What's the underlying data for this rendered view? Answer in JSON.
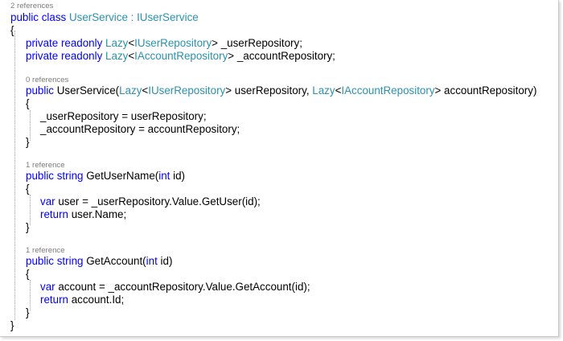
{
  "code_lens": {
    "class_refs": "2 references",
    "ctor_refs": "0 references",
    "getusername_refs": "1 reference",
    "getaccount_refs": "1 reference"
  },
  "tokens": {
    "public": "public",
    "class": "class",
    "private": "private",
    "readonly": "readonly",
    "string": "string",
    "int": "int",
    "var": "var",
    "return": "return",
    "Lazy": "Lazy",
    "IUserService": "IUserService",
    "IUserRepository": "IUserRepository",
    "IAccountRepository": "IAccountRepository"
  },
  "code": {
    "class_name": " UserService : ",
    "brace_open": "{",
    "brace_close": "}",
    "field1_lt": "<",
    "field1_rest": "> _userRepository;",
    "field2_lt": "<",
    "field2_rest": "> _accountRepository;",
    "ctor_name": " UserService(",
    "ctor_lt1": "<",
    "ctor_mid": "> userRepository, ",
    "ctor_lt2": "<",
    "ctor_end": "> accountRepository)",
    "ctor_body1": "_userRepository = userRepository;",
    "ctor_body2": "_accountRepository = accountRepository;",
    "m1_sig_a": " GetUserName(",
    "m1_sig_b": " id)",
    "m1_body1": " user = _userRepository.Value.GetUser(id);",
    "m1_body2": " user.Name;",
    "m2_sig_a": " GetAccount(",
    "m2_sig_b": " id)",
    "m2_body1": " account = _accountRepository.Value.GetAccount(id);",
    "m2_body2": " account.Id;"
  },
  "colors": {
    "keyword": "#0000ff",
    "type": "#2b91af",
    "identifier": "#000000",
    "code_lens": "#7c7c7c",
    "background": "#ffffff"
  }
}
